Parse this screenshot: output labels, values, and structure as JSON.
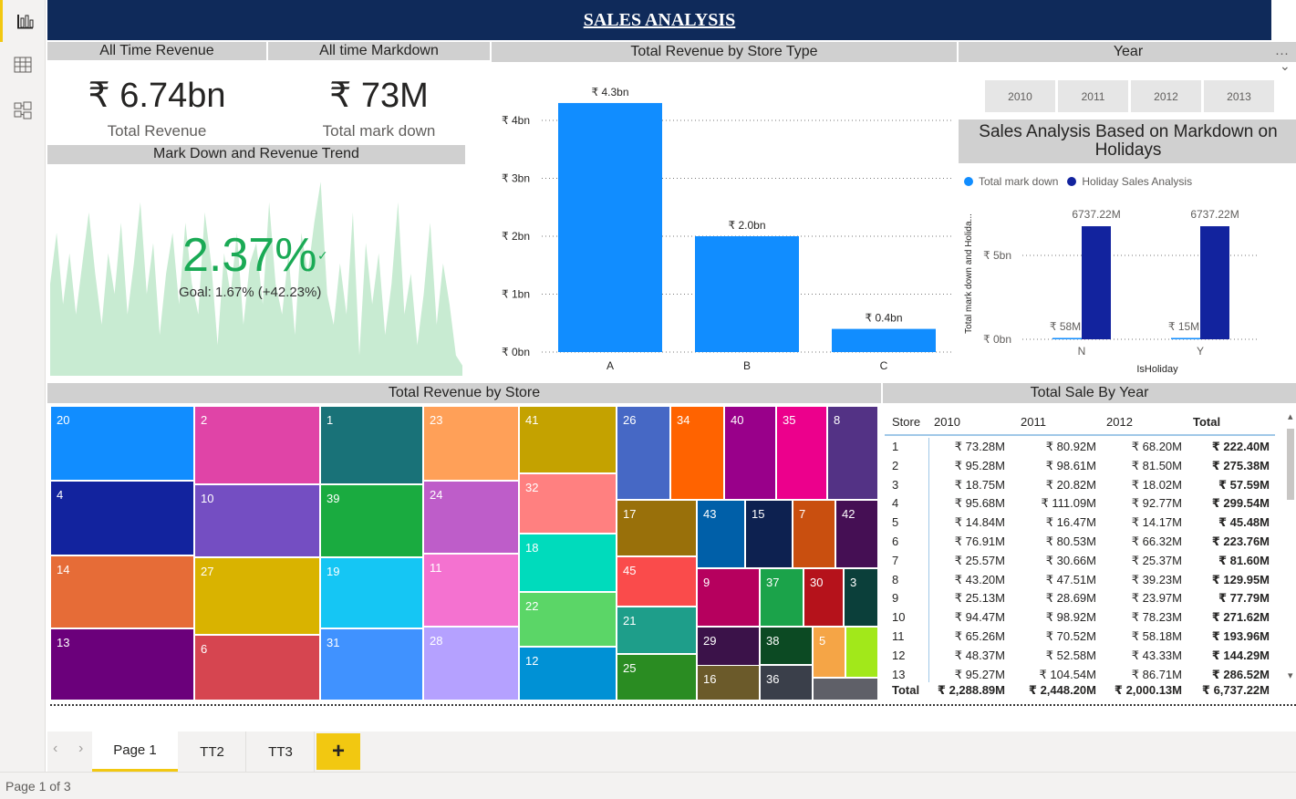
{
  "header": {
    "title": "SALES ANALYSIS"
  },
  "kpis": {
    "revenue_header": "All Time Revenue",
    "markdown_header": "All time Markdown",
    "revenue_value": "₹ 6.74bn",
    "revenue_label": "Total Revenue",
    "markdown_value": "₹ 73M",
    "markdown_label": "Total mark down"
  },
  "trend": {
    "header": "Mark Down and Revenue Trend",
    "value": "2.37%",
    "check": "✓",
    "goal": "Goal: 1.67% (+42.23%)"
  },
  "store_type_chart": {
    "header": "Total Revenue by Store Type"
  },
  "year_slicer": {
    "header": "Year",
    "options": [
      "2010",
      "2011",
      "2012",
      "2013"
    ],
    "more": "···",
    "chevron": "⌄"
  },
  "holiday_chart": {
    "header": "Sales Analysis Based on Markdown on Holidays",
    "legend": [
      "Total mark down",
      "Holiday Sales Analysis"
    ]
  },
  "treemap": {
    "header": "Total Revenue by Store",
    "cells": [
      {
        "label": "20",
        "color": "#118dff"
      },
      {
        "label": "4",
        "color": "#12239e"
      },
      {
        "label": "14",
        "color": "#e66c37"
      },
      {
        "label": "13",
        "color": "#6b007b"
      },
      {
        "label": "2",
        "color": "#e044a7"
      },
      {
        "label": "10",
        "color": "#744ec2"
      },
      {
        "label": "27",
        "color": "#d9b300"
      },
      {
        "label": "6",
        "color": "#d64550"
      },
      {
        "label": "1",
        "color": "#197278"
      },
      {
        "label": "39",
        "color": "#1aab40"
      },
      {
        "label": "19",
        "color": "#15c6f4"
      },
      {
        "label": "31",
        "color": "#4092ff"
      },
      {
        "label": "23",
        "color": "#ffa058"
      },
      {
        "label": "24",
        "color": "#be5dc9"
      },
      {
        "label": "11",
        "color": "#f472d0"
      },
      {
        "label": "28",
        "color": "#b5a1ff"
      },
      {
        "label": "41",
        "color": "#c4a200"
      },
      {
        "label": "32",
        "color": "#ff8080"
      },
      {
        "label": "18",
        "color": "#00dbbc"
      },
      {
        "label": "22",
        "color": "#5bd667"
      },
      {
        "label": "12",
        "color": "#0091d5"
      },
      {
        "label": "26",
        "color": "#4668c5"
      },
      {
        "label": "34",
        "color": "#ff6300"
      },
      {
        "label": "40",
        "color": "#99008a"
      },
      {
        "label": "35",
        "color": "#ec008c"
      },
      {
        "label": "8",
        "color": "#533285"
      },
      {
        "label": "17",
        "color": "#99700a"
      },
      {
        "label": "43",
        "color": "#005fa8"
      },
      {
        "label": "15",
        "color": "#0d2150"
      },
      {
        "label": "7",
        "color": "#c94f0f"
      },
      {
        "label": "42",
        "color": "#450f54"
      },
      {
        "label": "45",
        "color": "#fa4b4b"
      },
      {
        "label": "9",
        "color": "#b6005e"
      },
      {
        "label": "37",
        "color": "#1ba34a"
      },
      {
        "label": "30",
        "color": "#b5121b"
      },
      {
        "label": "3",
        "color": "#0b3f3a"
      },
      {
        "label": "21",
        "color": "#1e9e8a"
      },
      {
        "label": "29",
        "color": "#3b1249"
      },
      {
        "label": "38",
        "color": "#0c4a23"
      },
      {
        "label": "5",
        "color": "#f5a546"
      },
      {
        "label": "",
        "color": "#a2e81a"
      },
      {
        "label": "25",
        "color": "#2a8c22"
      },
      {
        "label": "16",
        "color": "#6b5a2a"
      },
      {
        "label": "36",
        "color": "#3a3f4a"
      },
      {
        "label": "",
        "color": "#5f6068"
      }
    ]
  },
  "sales_table": {
    "header": "Total Sale By Year",
    "columns": [
      "Store",
      "2010",
      "2011",
      "2012",
      "Total"
    ],
    "rows": [
      [
        "1",
        "₹ 73.28M",
        "₹ 80.92M",
        "₹ 68.20M",
        "₹ 222.40M"
      ],
      [
        "2",
        "₹ 95.28M",
        "₹ 98.61M",
        "₹ 81.50M",
        "₹ 275.38M"
      ],
      [
        "3",
        "₹ 18.75M",
        "₹ 20.82M",
        "₹ 18.02M",
        "₹ 57.59M"
      ],
      [
        "4",
        "₹ 95.68M",
        "₹ 111.09M",
        "₹ 92.77M",
        "₹ 299.54M"
      ],
      [
        "5",
        "₹ 14.84M",
        "₹ 16.47M",
        "₹ 14.17M",
        "₹ 45.48M"
      ],
      [
        "6",
        "₹ 76.91M",
        "₹ 80.53M",
        "₹ 66.32M",
        "₹ 223.76M"
      ],
      [
        "7",
        "₹ 25.57M",
        "₹ 30.66M",
        "₹ 25.37M",
        "₹ 81.60M"
      ],
      [
        "8",
        "₹ 43.20M",
        "₹ 47.51M",
        "₹ 39.23M",
        "₹ 129.95M"
      ],
      [
        "9",
        "₹ 25.13M",
        "₹ 28.69M",
        "₹ 23.97M",
        "₹ 77.79M"
      ],
      [
        "10",
        "₹ 94.47M",
        "₹ 98.92M",
        "₹ 78.23M",
        "₹ 271.62M"
      ],
      [
        "11",
        "₹ 65.26M",
        "₹ 70.52M",
        "₹ 58.18M",
        "₹ 193.96M"
      ],
      [
        "12",
        "₹ 48.37M",
        "₹ 52.58M",
        "₹ 43.33M",
        "₹ 144.29M"
      ],
      [
        "13",
        "₹ 95.27M",
        "₹ 104.54M",
        "₹ 86.71M",
        "₹ 286.52M"
      ]
    ],
    "total": [
      "Total",
      "₹ 2,288.89M",
      "₹ 2,448.20M",
      "₹ 2,000.13M",
      "₹ 6,737.22M"
    ]
  },
  "tabs": [
    "Page 1",
    "TT2",
    "TT3"
  ],
  "add_tab": "+",
  "status": "Page 1 of 3",
  "nav_prev": "‹",
  "nav_next": "›",
  "chart_data": [
    {
      "type": "bar",
      "categories": [
        "A",
        "B",
        "C"
      ],
      "values": [
        4.3,
        2.0,
        0.4
      ],
      "data_labels": [
        "₹ 4.3bn",
        "₹ 2.0bn",
        "₹ 0.4bn"
      ],
      "ylim": [
        0,
        4.3
      ],
      "yticks": [
        "₹ 0bn",
        "₹ 1bn",
        "₹ 2bn",
        "₹ 3bn",
        "₹ 4bn"
      ],
      "color": "#118dff"
    },
    {
      "type": "bar",
      "categories": [
        "N",
        "Y"
      ],
      "series": [
        {
          "name": "Total mark down",
          "values": [
            58,
            15
          ],
          "labels": [
            "₹ 58M",
            "₹ 15M"
          ],
          "color": "#118dff"
        },
        {
          "name": "Holiday Sales Analysis",
          "values": [
            6737.22,
            6737.22
          ],
          "labels": [
            "6737.22M",
            "6737.22M"
          ],
          "color": "#12239e"
        }
      ],
      "xlabel": "IsHoliday",
      "ylabel": "Total mark down and Holida...",
      "yticks": [
        "₹ 0bn",
        "₹ 5bn"
      ],
      "ylim": [
        0,
        7500
      ]
    },
    {
      "type": "area",
      "color": "#c8ebd2",
      "values": [
        0.45,
        0.7,
        0.35,
        0.6,
        0.3,
        0.55,
        0.8,
        0.5,
        0.25,
        0.6,
        0.4,
        0.75,
        0.3,
        0.55,
        0.85,
        0.4,
        0.65,
        0.2,
        0.5,
        0.7,
        0.35,
        0.75,
        0.45,
        0.3,
        0.8,
        0.55,
        0.15,
        0.6,
        0.4,
        0.7,
        0.25,
        0.55,
        0.65,
        0.35,
        0.85,
        0.45,
        0.3,
        0.6,
        0.2,
        0.7,
        0.5,
        0.75,
        0.95,
        0.4,
        0.25,
        0.55,
        0.3,
        0.8,
        0.1,
        0.65,
        0.35,
        0.6,
        0.2,
        0.45,
        0.85,
        0.3,
        0.5,
        0.15,
        0.4,
        0.75,
        0.25,
        0.55,
        0.35,
        0.1,
        0.05
      ]
    }
  ]
}
